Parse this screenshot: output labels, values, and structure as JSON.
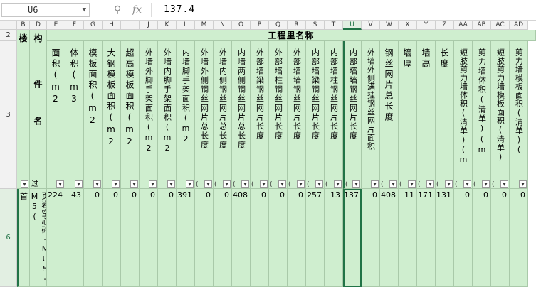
{
  "formula_bar": {
    "cell_ref": "U6",
    "fx_label": "fx",
    "value": "137.4"
  },
  "columns": [
    "B",
    "D",
    "E",
    "F",
    "G",
    "H",
    "I",
    "J",
    "K",
    "L",
    "M",
    "N",
    "O",
    "P",
    "Q",
    "R",
    "S",
    "T",
    "U",
    "V",
    "W",
    "X",
    "Y",
    "Z",
    "AA",
    "AB",
    "AC",
    "AD"
  ],
  "rows": [
    "2",
    "3",
    "6"
  ],
  "header": {
    "floor": "楼",
    "component": "构",
    "component_name": "件名",
    "engineering_title": "工程里名称",
    "filter_B": "▼",
    "filter_D": "过",
    "headers": [
      {
        "col": "E",
        "text": "面积(m2"
      },
      {
        "col": "F",
        "text": "体积(m3"
      },
      {
        "col": "G",
        "text": "模板面积(m2"
      },
      {
        "col": "H",
        "text": "大钢模板面积(m2"
      },
      {
        "col": "I",
        "text": "超高模板面积(m2"
      },
      {
        "col": "J",
        "text": "外墙外脚手架面积(m2"
      },
      {
        "col": "K",
        "text": "外墙内脚手架面积(m2"
      },
      {
        "col": "L",
        "text": "内墙脚手架面积(m2"
      },
      {
        "col": "M",
        "text": "外墙外侧钢丝网片总长度"
      },
      {
        "col": "N",
        "text": "外墙内侧钢丝网片总长度"
      },
      {
        "col": "O",
        "text": "内墙两侧钢丝网片总长度"
      },
      {
        "col": "P",
        "text": "外部墙梁钢丝网片长度"
      },
      {
        "col": "Q",
        "text": "外部墙柱钢丝网片长度"
      },
      {
        "col": "R",
        "text": "外部墙墙钢丝网片长度"
      },
      {
        "col": "S",
        "text": "内部墙梁钢丝网片长度"
      },
      {
        "col": "T",
        "text": "内部墙柱钢丝网片长度"
      },
      {
        "col": "U",
        "text": "内部墙墙钢丝网片长度"
      },
      {
        "col": "V",
        "text": "外墙外侧满挂钢丝网片面积"
      },
      {
        "col": "W",
        "text": "钢丝网片总长度"
      },
      {
        "col": "X",
        "text": "墙厚"
      },
      {
        "col": "Y",
        "text": "墙高"
      },
      {
        "col": "Z",
        "text": "长度"
      },
      {
        "col": "AA",
        "text": "短肢剪力墙体积(清单)(m"
      },
      {
        "col": "AB",
        "text": "剪力墙体积(清单)(m"
      },
      {
        "col": "AC",
        "text": "短肢剪力墙模板面积(清单)"
      },
      {
        "col": "AD",
        "text": "剪力墙模板面积(清单)("
      }
    ]
  },
  "row6": {
    "floor": "首",
    "component": "页岩空心砖-MU5-M5(",
    "values": [
      "224",
      "43",
      "0",
      "0",
      "0",
      "0",
      "0",
      "391",
      "0",
      "0",
      "408",
      "0",
      "0",
      "0",
      "257",
      "13",
      "137",
      "0",
      "408",
      "11",
      "171",
      "131",
      "0",
      "0",
      "0",
      "0"
    ]
  }
}
